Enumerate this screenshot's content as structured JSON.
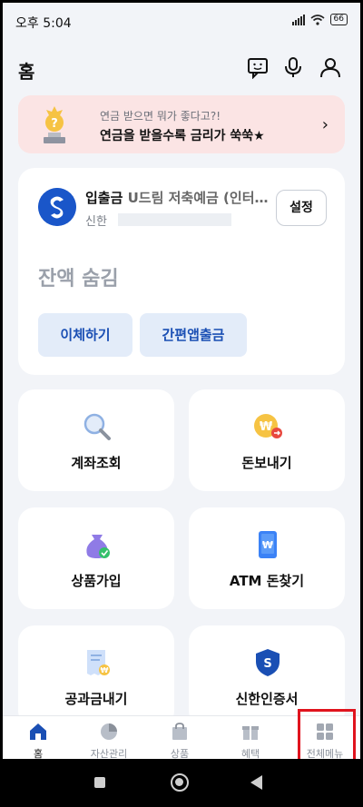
{
  "status_bar": {
    "time": "오후 5:04",
    "battery": "66"
  },
  "header": {
    "title": "홈",
    "icons": [
      "chat-icon",
      "microphone-icon",
      "profile-icon"
    ]
  },
  "banner": {
    "subtitle": "연금 받으면 뭐가 좋다고?!",
    "title": "연금을 받을수록 금리가 쑥쑥★",
    "chevron": "›"
  },
  "account": {
    "name_strong": "입출금",
    "name_rest": " U드림 저축예금 (인터…",
    "bank": "신한",
    "settings_label": "설정",
    "balance_hidden": "잔액 숨김",
    "transfer_label": "이체하기",
    "easy_withdraw_label": "간편앱출금"
  },
  "tiles": [
    {
      "label": "계좌조회",
      "icon": "search-icon"
    },
    {
      "label": "돈보내기",
      "icon": "send-money-icon"
    },
    {
      "label": "상품가입",
      "icon": "product-bag-icon"
    },
    {
      "label": "ATM 돈찾기",
      "icon": "atm-phone-icon"
    },
    {
      "label": "공과금내기",
      "icon": "bill-icon"
    },
    {
      "label": "신한인증서",
      "icon": "certificate-shield-icon"
    }
  ],
  "bottom_nav": [
    {
      "label": "홈",
      "icon": "home-icon",
      "active": true
    },
    {
      "label": "자산관리",
      "icon": "pie-chart-icon"
    },
    {
      "label": "상품",
      "icon": "shopping-bag-icon"
    },
    {
      "label": "혜택",
      "icon": "gift-icon"
    },
    {
      "label": "전체메뉴",
      "icon": "grid-menu-icon"
    }
  ],
  "colors": {
    "accent_blue": "#1a4fb4",
    "banner_bg": "#fbe4e4",
    "highlight_red": "#e0141e"
  }
}
